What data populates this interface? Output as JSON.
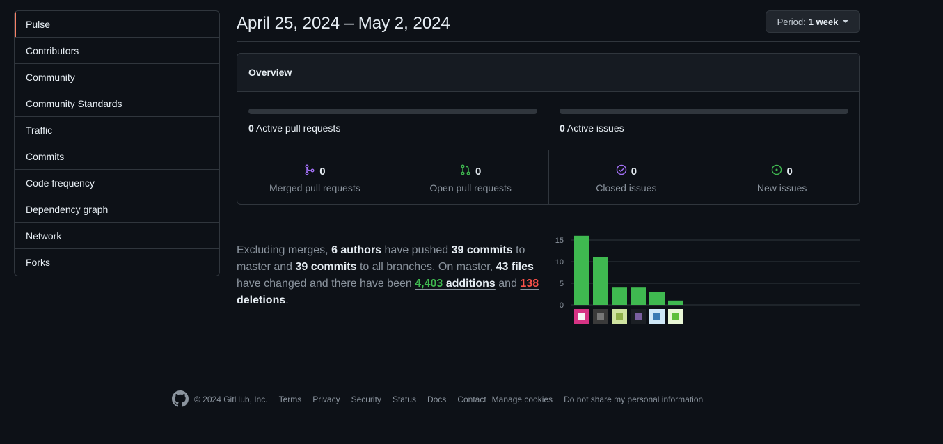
{
  "sidebar": {
    "items": [
      {
        "label": "Pulse",
        "selected": true
      },
      {
        "label": "Contributors"
      },
      {
        "label": "Community"
      },
      {
        "label": "Community Standards"
      },
      {
        "label": "Traffic"
      },
      {
        "label": "Commits"
      },
      {
        "label": "Code frequency"
      },
      {
        "label": "Dependency graph"
      },
      {
        "label": "Network"
      },
      {
        "label": "Forks"
      }
    ]
  },
  "header": {
    "date_range": "April 25, 2024 – May 2, 2024",
    "period_label": "Period:",
    "period_value": "1 week"
  },
  "overview": {
    "title": "Overview",
    "active_prs_count": "0",
    "active_prs_label": "Active pull requests",
    "active_issues_count": "0",
    "active_issues_label": "Active issues",
    "stats": [
      {
        "icon": "git-merge-icon",
        "count": "0",
        "label": "Merged pull requests",
        "color": "#a371f7"
      },
      {
        "icon": "git-pull-request-icon",
        "count": "0",
        "label": "Open pull requests",
        "color": "#3fb950"
      },
      {
        "icon": "issue-closed-icon",
        "count": "0",
        "label": "Closed issues",
        "color": "#a371f7"
      },
      {
        "icon": "issue-opened-icon",
        "count": "0",
        "label": "New issues",
        "color": "#3fb950"
      }
    ]
  },
  "summary": {
    "t1": "Excluding merges, ",
    "authors": "6 authors",
    "t2": " have pushed ",
    "commits_master": "39 commits",
    "t3": " to master and ",
    "commits_all": "39 commits",
    "t4": " to all branches. On master, ",
    "files": "43 files",
    "t5": " have changed and there have been ",
    "additions_num": "4,403",
    "additions_word": " additions",
    "t6": " and ",
    "deletions_num": "138",
    "deletions_word": " deletions",
    "t7": "."
  },
  "chart_data": {
    "type": "bar",
    "categories": [
      "author-1",
      "author-2",
      "author-3",
      "author-4",
      "author-5",
      "author-6"
    ],
    "values": [
      16,
      11,
      4,
      4,
      3,
      1
    ],
    "yticks": [
      "0",
      "5",
      "10",
      "15"
    ],
    "ylim": [
      0,
      15
    ],
    "bar_color": "#3fb950"
  },
  "footer": {
    "copyright": "© 2024 GitHub, Inc.",
    "links": [
      "Terms",
      "Privacy",
      "Security",
      "Status",
      "Docs",
      "Contact",
      "Manage cookies",
      "Do not share my personal information"
    ]
  }
}
